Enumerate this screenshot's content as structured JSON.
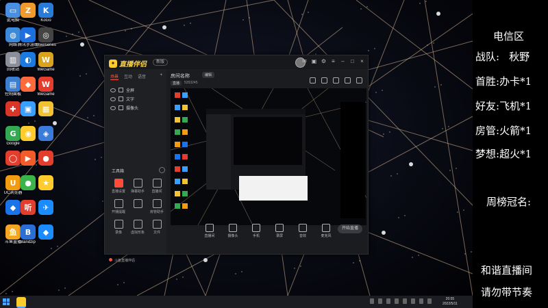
{
  "desktop": {
    "icons": [
      {
        "label": "此电脑",
        "color": "#4a8fdf",
        "glyph": "▭"
      },
      {
        "label": "",
        "color": "#f09a2d",
        "glyph": "Z"
      },
      {
        "label": "KoGo",
        "color": "#2a7bd8",
        "glyph": "K"
      },
      {
        "label": "网络",
        "color": "#3b8ad9",
        "glyph": "◍"
      },
      {
        "label": "腾讯手游助手",
        "color": "#1d6fe0",
        "glyph": "▶"
      },
      {
        "label": "Steelseries",
        "color": "#444444",
        "glyph": "◎"
      },
      {
        "label": "回收站",
        "color": "#8a8f99",
        "glyph": "▥"
      },
      {
        "label": "",
        "color": "#1a7ae0",
        "glyph": "◐"
      },
      {
        "label": "WeGame",
        "color": "#d9a21f",
        "glyph": "W"
      },
      {
        "label": "控制面板",
        "color": "#3c7fd0",
        "glyph": "▤"
      },
      {
        "label": "",
        "color": "#ff6a3d",
        "glyph": "◆"
      },
      {
        "label": "WeGame",
        "color": "#e23d2d",
        "glyph": "W"
      },
      {
        "label": "",
        "color": "#d9362a",
        "glyph": "✚"
      },
      {
        "label": "",
        "color": "#3aa0ff",
        "glyph": "▣"
      },
      {
        "label": "",
        "color": "#f1c232",
        "glyph": "▦"
      },
      {
        "label": "Google",
        "color": "#34a853",
        "glyph": "G"
      },
      {
        "label": "",
        "color": "#ffcc2e",
        "glyph": "◉"
      },
      {
        "label": "",
        "color": "#3b7bd9",
        "glyph": "◈"
      },
      {
        "label": "",
        "color": "#e23d2d",
        "glyph": "◯"
      },
      {
        "label": "",
        "color": "#f25c2b",
        "glyph": "▶"
      },
      {
        "label": "",
        "color": "#e23d2d",
        "glyph": "●"
      },
      {
        "label": "UC浏览器",
        "color": "#f39c12",
        "glyph": "U"
      },
      {
        "label": "",
        "color": "#3ab54a",
        "glyph": "●"
      },
      {
        "label": "",
        "color": "#ffcc2e",
        "glyph": "★"
      },
      {
        "label": "",
        "color": "#1a73e8",
        "glyph": "◆"
      },
      {
        "label": "",
        "color": "#e23d2d",
        "glyph": "听"
      },
      {
        "label": "",
        "color": "#1a8cff",
        "glyph": "✈"
      },
      {
        "label": "斗鱼直播",
        "color": "#f5a623",
        "glyph": "鱼"
      },
      {
        "label": "Bandzip",
        "color": "#2b6fd6",
        "glyph": "B"
      },
      {
        "label": "",
        "color": "#1a8cff",
        "glyph": "◆"
      }
    ]
  },
  "app": {
    "name": "直播伴侣",
    "mode_badge": "新版",
    "tabs": [
      "场景",
      "互动",
      "语音"
    ],
    "plus": "+",
    "scenes": [
      "全屏",
      "文字",
      "摄像头"
    ],
    "tools_label": "工具箱",
    "tools": [
      "直播设置",
      "弹幕助手",
      "直播间",
      "开播提醒",
      "",
      "房管助手",
      "录像",
      "虚拟形象",
      "文件"
    ],
    "tip": "斗鱼直播伴侣",
    "room_title": "房间名称",
    "room_tag": "编辑",
    "room_meta": [
      "直播",
      "",
      "",
      "5353245"
    ],
    "bottom_tools": [
      "直播间",
      "摄像头",
      "手机",
      "录屏",
      "音效",
      "麦克风"
    ],
    "start_button": "开始直播",
    "status_left": "",
    "status_right": ""
  },
  "info_panel": {
    "region": "电信区",
    "team_label": "战队:",
    "team_value": "秋野",
    "first_win_label": "首胜:",
    "first_win_value": "办卡*1",
    "friend_label": "好友:",
    "friend_value": "飞机*1",
    "room_admin_label": "房管:",
    "room_admin_value": "火箭*1",
    "dream_label": "梦想:",
    "dream_value": "超火*1",
    "weekly_label": "周榜冠名:",
    "slogan_1": "和谐直播间",
    "slogan_2": "请勿带节奏"
  },
  "taskbar": {
    "time": "20:55",
    "date": "2022/5/11"
  }
}
